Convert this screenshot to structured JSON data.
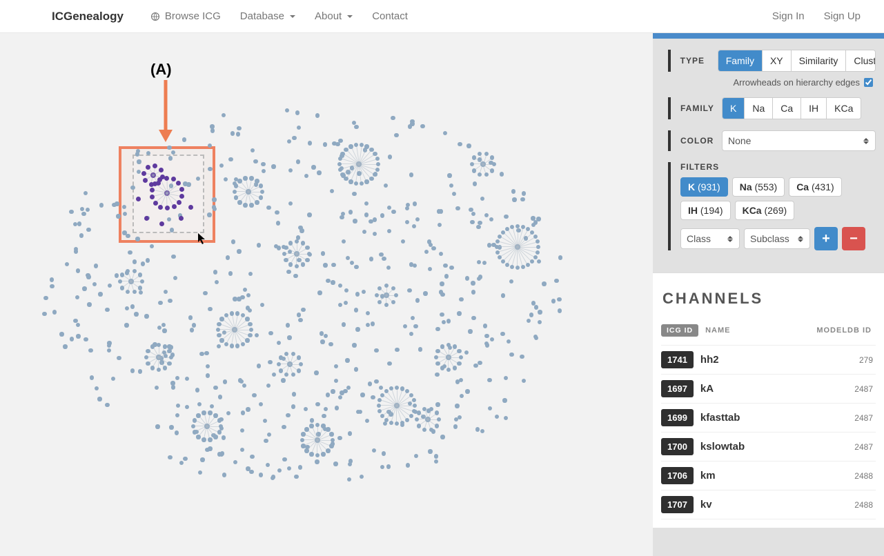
{
  "nav": {
    "brand": "ICGenealogy",
    "browse": "Browse ICG",
    "database": "Database",
    "about": "About",
    "contact": "Contact",
    "signin": "Sign In",
    "signup": "Sign Up"
  },
  "help_glyph": "?",
  "annotation": {
    "label": "(A)"
  },
  "sidebar": {
    "type": {
      "label": "TYPE",
      "options": [
        "Family",
        "XY",
        "Similarity",
        "Cluster"
      ],
      "active": "Family",
      "arrowheads_label": "Arrowheads on hierarchy edges",
      "arrowheads_checked": true
    },
    "family": {
      "label": "FAMILY",
      "options": [
        "K",
        "Na",
        "Ca",
        "IH",
        "KCa"
      ],
      "active": "K"
    },
    "color": {
      "label": "COLOR",
      "value": "None"
    },
    "filters": {
      "label": "FILTERS",
      "pills": [
        {
          "name": "K",
          "count": 931,
          "active": true
        },
        {
          "name": "Na",
          "count": 553,
          "active": false
        },
        {
          "name": "Ca",
          "count": 431,
          "active": false
        },
        {
          "name": "IH",
          "count": 194,
          "active": false
        },
        {
          "name": "KCa",
          "count": 269,
          "active": false
        }
      ],
      "class_label": "Class",
      "subclass_label": "Subclass",
      "add_glyph": "+",
      "remove_glyph": "−"
    }
  },
  "channels": {
    "title": "CHANNELS",
    "header": {
      "icg_id": "ICG ID",
      "name": "NAME",
      "modeldb": "MODELDB ID"
    },
    "rows": [
      {
        "id": "1741",
        "name": "hh2",
        "model": "279"
      },
      {
        "id": "1697",
        "name": "kA",
        "model": "2487"
      },
      {
        "id": "1699",
        "name": "kfasttab",
        "model": "2487"
      },
      {
        "id": "1700",
        "name": "kslowtab",
        "model": "2487"
      },
      {
        "id": "1706",
        "name": "km",
        "model": "2488"
      },
      {
        "id": "1707",
        "name": "kv",
        "model": "2488"
      }
    ]
  }
}
